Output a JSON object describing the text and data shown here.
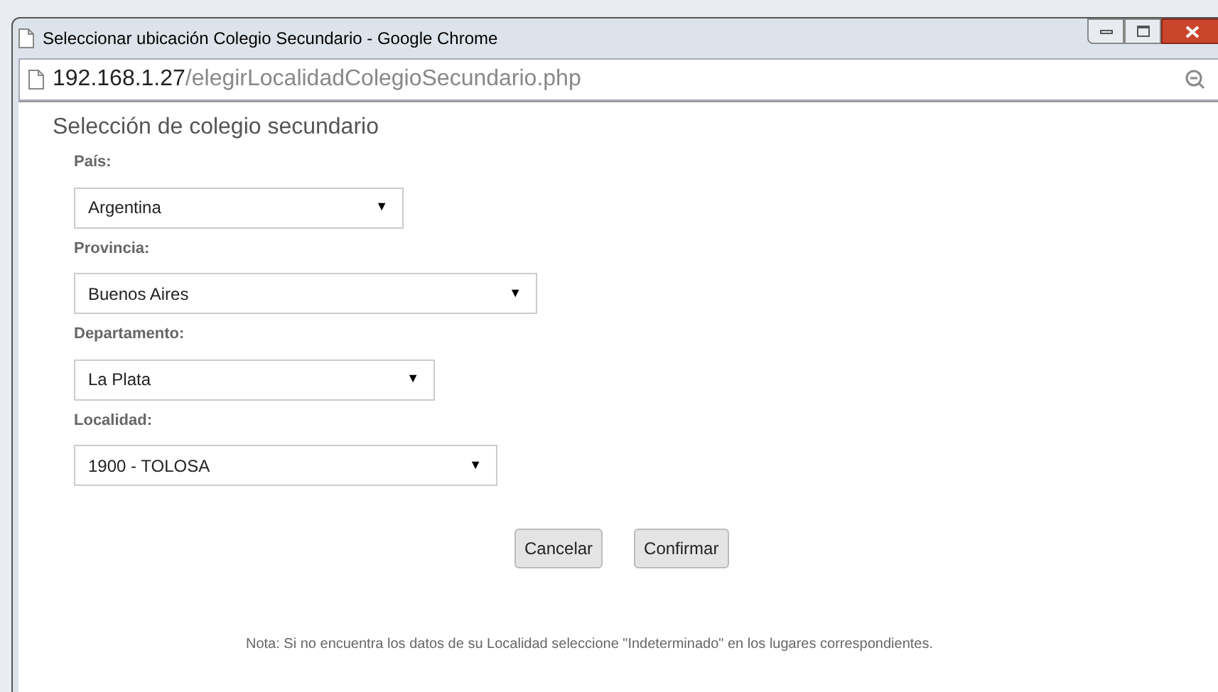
{
  "window": {
    "title": "Seleccionar ubicación Colegio Secundario - Google Chrome"
  },
  "address_bar": {
    "host": "192.168.1.27",
    "path": "/elegirLocalidadColegioSecundario.php"
  },
  "form": {
    "heading": "Selección de colegio secundario",
    "fields": [
      {
        "label": "País:",
        "value": "Argentina",
        "caret": "▼"
      },
      {
        "label": "Provincia:",
        "value": "Buenos Aires",
        "caret": "▼"
      },
      {
        "label": "Departamento:",
        "value": "La Plata",
        "caret": "▼"
      },
      {
        "label": "Localidad:",
        "value": "1900 - TOLOSA",
        "caret": "▼"
      }
    ],
    "buttons": [
      "Cancelar",
      "Confirmar"
    ],
    "note": "Nota: Si no encuentra los datos de su Localidad seleccione \"Indeterminado\" en los lugares correspondientes."
  }
}
